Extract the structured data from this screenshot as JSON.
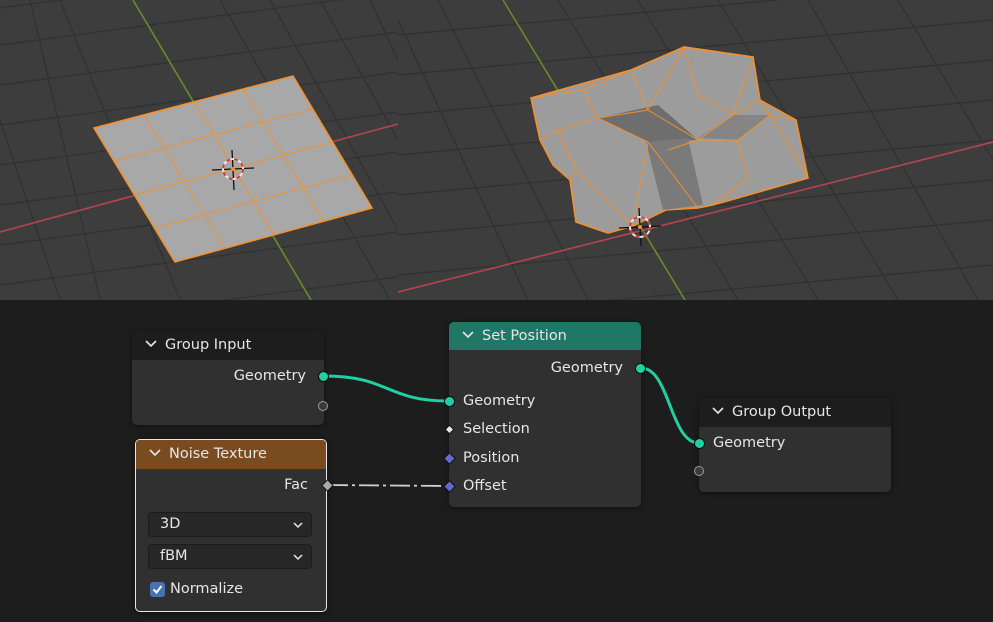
{
  "colors": {
    "viewport_bg": "#3d3d3d",
    "grid": "#303030",
    "x_axis": "#b34452",
    "y_axis": "#6a8a2a",
    "mesh_face": "#a8a8a8",
    "selection_edge": "#f2902e",
    "editor_bg": "#1d1d1d",
    "node_body": "#303030",
    "geometry_socket": "#20d0a2",
    "vector_socket": "#6469cc",
    "set_position_header": "#1e7865",
    "noise_texture_header": "#7b4b20",
    "checkbox": "#4772b3"
  },
  "viewports": {
    "left": {
      "object": "flat-plane",
      "icon": "3d-cursor-icon"
    },
    "right": {
      "object": "displaced-plane",
      "icon": "3d-cursor-icon"
    }
  },
  "nodes": {
    "group_input": {
      "title": "Group Input",
      "outputs": [
        "Geometry"
      ]
    },
    "set_position": {
      "title": "Set Position",
      "output": "Geometry",
      "inputs": [
        "Geometry",
        "Selection",
        "Position",
        "Offset"
      ]
    },
    "group_output": {
      "title": "Group Output",
      "inputs": [
        "Geometry"
      ]
    },
    "noise_texture": {
      "title": "Noise Texture",
      "output": "Fac",
      "dimensions": "3D",
      "type": "fBM",
      "normalize_label": "Normalize",
      "normalize": true
    }
  },
  "links": [
    {
      "from": "Group Input.Geometry",
      "to": "Set Position.Geometry"
    },
    {
      "from": "Set Position.Geometry",
      "to": "Group Output.Geometry"
    },
    {
      "from": "Noise Texture.Fac",
      "to": "Set Position.Offset"
    }
  ]
}
